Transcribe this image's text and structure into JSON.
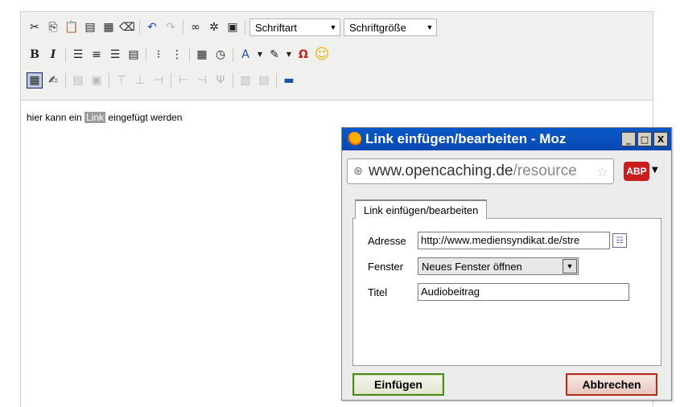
{
  "editor": {
    "toolbar": {
      "font_combo": "Schriftart",
      "size_combo": "Schriftgröße",
      "bold_glyph": "B",
      "italic_glyph": "I",
      "omega_glyph": "Ω",
      "textcolor_glyph": "A"
    },
    "content": {
      "before": "hier kann ein ",
      "link": "Link",
      "after": " eingefügt werden"
    }
  },
  "dialog": {
    "title": "Link einfügen/bearbeiten - Moz",
    "window_buttons": {
      "minimize": "_",
      "maximize": "□",
      "close": "X"
    },
    "url": {
      "domain": "www.opencaching.de",
      "path": "/resource"
    },
    "abp_label": "ABP",
    "tab_label": "Link einfügen/bearbeiten",
    "fields": {
      "address_label": "Adresse",
      "address_value": "http://www.mediensyndikat.de/stre",
      "window_label": "Fenster",
      "window_value": "Neues Fenster öffnen",
      "title_label": "Titel",
      "title_value": "Audiobeitrag"
    },
    "buttons": {
      "insert": "Einfügen",
      "cancel": "Abbrechen"
    }
  }
}
